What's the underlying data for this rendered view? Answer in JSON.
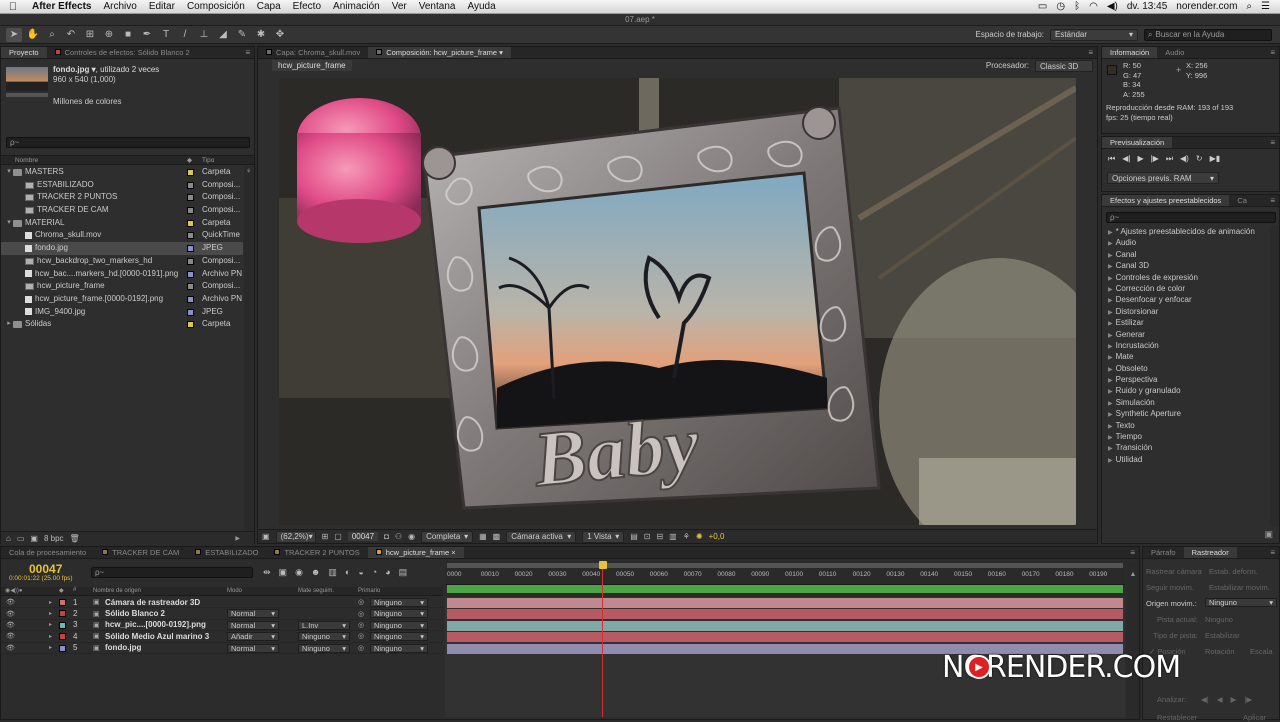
{
  "menubar": {
    "app": "After Effects",
    "items": [
      "Archivo",
      "Editar",
      "Composición",
      "Capa",
      "Efecto",
      "Animación",
      "Ver",
      "Ventana",
      "Ayuda"
    ],
    "clock": "dv. 13:45",
    "site": "norender.com"
  },
  "window_title": "07.aep *",
  "toolbar": {
    "workspace_label": "Espacio de trabajo:",
    "workspace_value": "Estándar",
    "help_placeholder": "Buscar en la Ayuda"
  },
  "project": {
    "tabs": [
      "Proyecto",
      "Controles de efectos: Sólido Blanco 2"
    ],
    "preview_name": "fondo.jpg ▾",
    "preview_used": ", utilizado 2 veces",
    "preview_size": "960 x 540 (1,000)",
    "preview_colors": "Millones de colores",
    "search_placeholder": "ρ~",
    "col_name": "Nombre",
    "col_type": "Tipo",
    "items": [
      {
        "name": "MASTERS",
        "type": "Carpeta",
        "indent": 0,
        "icon": "folder",
        "twirl": "▾",
        "color": "#d9c94a"
      },
      {
        "name": "ESTABILIZADO",
        "type": "Composi...",
        "indent": 1,
        "icon": "comp",
        "twirl": "",
        "color": "#8a8a8a"
      },
      {
        "name": "TRACKER 2 PUNTOS",
        "type": "Composi...",
        "indent": 1,
        "icon": "comp",
        "twirl": "",
        "color": "#8a8a8a"
      },
      {
        "name": "TRACKER DE CAM",
        "type": "Composi...",
        "indent": 1,
        "icon": "comp",
        "twirl": "",
        "color": "#8a8a8a"
      },
      {
        "name": "MATERIAL",
        "type": "Carpeta",
        "indent": 0,
        "icon": "folder",
        "twirl": "▾",
        "color": "#d9c94a"
      },
      {
        "name": "Chroma_skull.mov",
        "type": "QuickTime",
        "indent": 1,
        "icon": "file",
        "twirl": "",
        "color": "#8a8a8a"
      },
      {
        "name": "fondo.jpg",
        "type": "JPEG",
        "indent": 1,
        "icon": "file",
        "twirl": "",
        "color": "#8d8fc9",
        "selected": true
      },
      {
        "name": "hcw_backdrop_two_markers_hd",
        "type": "Composi...",
        "indent": 1,
        "icon": "comp",
        "twirl": "",
        "color": "#8a8a8a"
      },
      {
        "name": "hcw_bac....markers_hd.[0000-0191].png",
        "type": "Archivo PN",
        "indent": 1,
        "icon": "file",
        "twirl": "",
        "color": "#8d8fc9"
      },
      {
        "name": "hcw_picture_frame",
        "type": "Composi...",
        "indent": 1,
        "icon": "comp",
        "twirl": "",
        "color": "#8a8a8a"
      },
      {
        "name": "hcw_picture_frame.[0000-0192].png",
        "type": "Archivo PN",
        "indent": 1,
        "icon": "file",
        "twirl": "",
        "color": "#8d8fc9"
      },
      {
        "name": "IMG_9400.jpg",
        "type": "JPEG",
        "indent": 1,
        "icon": "file",
        "twirl": "",
        "color": "#8d8fc9"
      },
      {
        "name": "Sólidas",
        "type": "Carpeta",
        "indent": 0,
        "icon": "folder",
        "twirl": "▸",
        "color": "#d9c94a"
      }
    ],
    "bpc": "8 bpc"
  },
  "viewer": {
    "tabs": [
      "Capa: Chroma_skull.mov",
      "Composición: hcw_picture_frame"
    ],
    "subtab": "hcw_picture_frame",
    "processor_label": "Procesador:",
    "processor_value": "Classic 3D",
    "frame_word": "Baby",
    "zoom": "(62,2%)",
    "timecode": "00047",
    "resolution": "Completa",
    "camera": "Cámara activa",
    "views": "1 Vista",
    "exposure": "+0,0"
  },
  "info": {
    "tabs": [
      "Información",
      "Audio"
    ],
    "r": "R:  50",
    "g": "G:  47",
    "b": "B:  34",
    "a": "A:  255",
    "x": "X:  256",
    "y": "Y:  996",
    "ram": "Reproducción desde RAM: 193 of 193",
    "fps": "fps: 25 (tiempo real)"
  },
  "preview": {
    "tab": "Previsualización",
    "options": "Opciones previs. RAM"
  },
  "effects": {
    "tabs": [
      "Efectos y ajustes preestablecidos",
      "Ca"
    ],
    "search_placeholder": "ρ~",
    "items": [
      "* Ajustes preestablecidos de animación",
      "Audio",
      "Canal",
      "Canal 3D",
      "Controles de expresión",
      "Corrección de color",
      "Desenfocar y enfocar",
      "Distorsionar",
      "Estilizar",
      "Generar",
      "Incrustación",
      "Mate",
      "Obsoleto",
      "Perspectiva",
      "Ruido y granulado",
      "Simulación",
      "Synthetic Aperture",
      "Texto",
      "Tiempo",
      "Transición",
      "Utilidad"
    ]
  },
  "timeline": {
    "tabs": [
      "Cola de procesamiento",
      "TRACKER DE CAM",
      "ESTABILIZADO",
      "TRACKER 2 PUNTOS",
      "hcw_picture_frame"
    ],
    "timecode": "00047",
    "timecode_sub": "0:00:01:22 (25.00 fps)",
    "search_placeholder": "ρ~",
    "col_source": "Nombre de origen",
    "col_mode": "Modo",
    "col_matte": "Mate seguim.",
    "col_parent": "Primario",
    "ruler": [
      "0000",
      "00010",
      "00020",
      "00030",
      "00040",
      "00050",
      "00060",
      "00070",
      "00080",
      "00090",
      "00100",
      "00110",
      "00120",
      "00130",
      "00140",
      "00150",
      "00160",
      "00170",
      "00180",
      "00190"
    ],
    "current_frame": 47,
    "total_frames": 193,
    "layers": [
      {
        "num": "1",
        "name": "Cámara de rastreador 3D",
        "mode": "",
        "t": "",
        "matte": "",
        "parent": "Ninguno",
        "color": "#d07070",
        "bar": "#c28890"
      },
      {
        "num": "2",
        "name": "Sólido Blanco 2",
        "mode": "Normal",
        "t": "",
        "matte": "",
        "parent": "Ninguno",
        "color": "#c84040",
        "bar": "#b75a64"
      },
      {
        "num": "3",
        "name": "hcw_pic....[0000-0192].png",
        "mode": "Normal",
        "t": "",
        "matte": "L.Inv",
        "parent": "Ninguno",
        "color": "#6fb9b4",
        "bar": "#7fa8a6"
      },
      {
        "num": "4",
        "name": "Sólido Medio Azul marino 3",
        "mode": "Añadir",
        "t": "",
        "matte": "Ninguno",
        "parent": "Ninguno",
        "color": "#c84040",
        "bar": "#b75a64"
      },
      {
        "num": "5",
        "name": "fondo.jpg",
        "mode": "Normal",
        "t": "",
        "matte": "Ninguno",
        "parent": "Ninguno",
        "color": "#8d8fc9",
        "bar": "#8f8cae"
      }
    ]
  },
  "tracker": {
    "tabs": [
      "Párrafo",
      "Rastreador"
    ],
    "btn_cam": "Rastrear cámara",
    "btn_warp": "Estab. deform.",
    "btn_follow": "Seguir movim.",
    "btn_stab": "Estabilizar movim.",
    "origin_label": "Origen movim.:",
    "origin_value": "Ninguno",
    "track_label": "Pista actual:",
    "track_value": "Ninguno",
    "type_label": "Tipo de pista:",
    "type_value": "Estabilizar",
    "opt_pos": "Posición",
    "opt_rot": "Rotación",
    "opt_scale": "Escala",
    "analyze_label": "Analizar:",
    "btn_reset": "Restablecer",
    "btn_apply": "Aplicar"
  },
  "watermark": {
    "text": "NORENDER.COM"
  }
}
